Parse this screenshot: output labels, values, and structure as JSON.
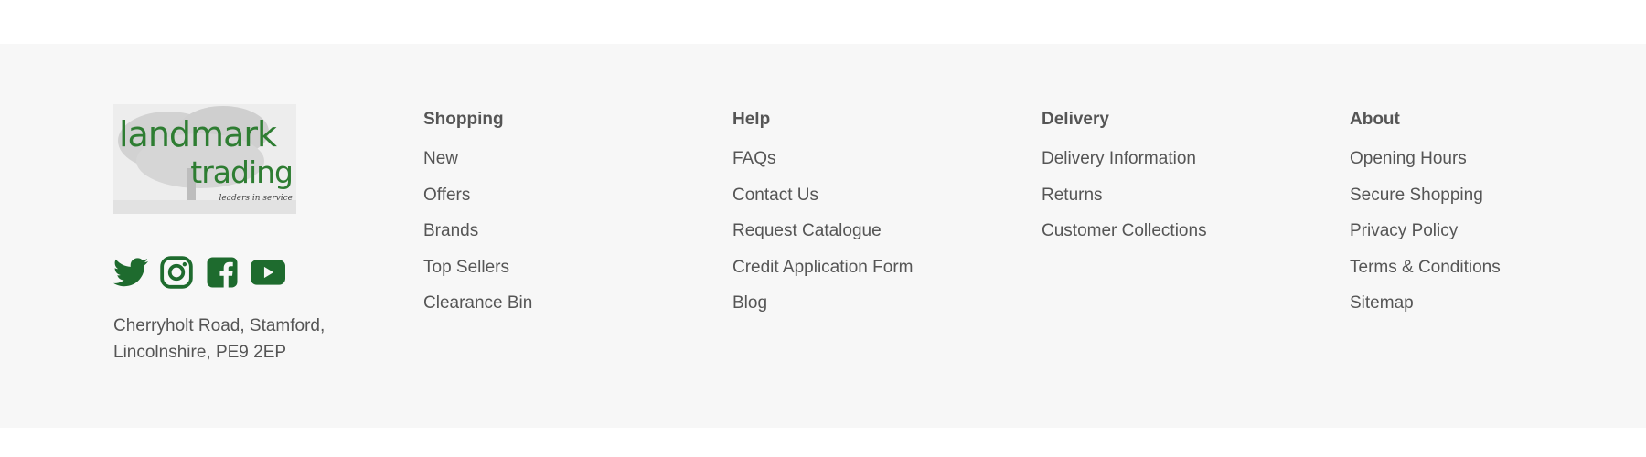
{
  "brand": {
    "logo_word1": "landmark",
    "logo_word2": "trading",
    "logo_tagline": "leaders in service",
    "address_line1": "Cherryholt Road, Stamford,",
    "address_line2": "Lincolnshire, PE9 2EP"
  },
  "socials": [
    {
      "icon": "twitter-icon"
    },
    {
      "icon": "instagram-icon"
    },
    {
      "icon": "facebook-icon"
    },
    {
      "icon": "youtube-icon"
    }
  ],
  "colors": {
    "brand_green": "#1e6b2e",
    "footer_bg": "#f7f7f7",
    "text": "#555555"
  },
  "columns": [
    {
      "heading": "Shopping",
      "links": [
        "New",
        "Offers",
        "Brands",
        "Top Sellers",
        "Clearance Bin"
      ]
    },
    {
      "heading": "Help",
      "links": [
        "FAQs",
        "Contact Us",
        "Request Catalogue",
        "Credit Application Form",
        "Blog"
      ]
    },
    {
      "heading": "Delivery",
      "links": [
        "Delivery Information",
        "Returns",
        "Customer Collections"
      ]
    },
    {
      "heading": "About",
      "links": [
        "Opening Hours",
        "Secure Shopping",
        "Privacy Policy",
        "Terms & Conditions",
        "Sitemap"
      ]
    }
  ]
}
